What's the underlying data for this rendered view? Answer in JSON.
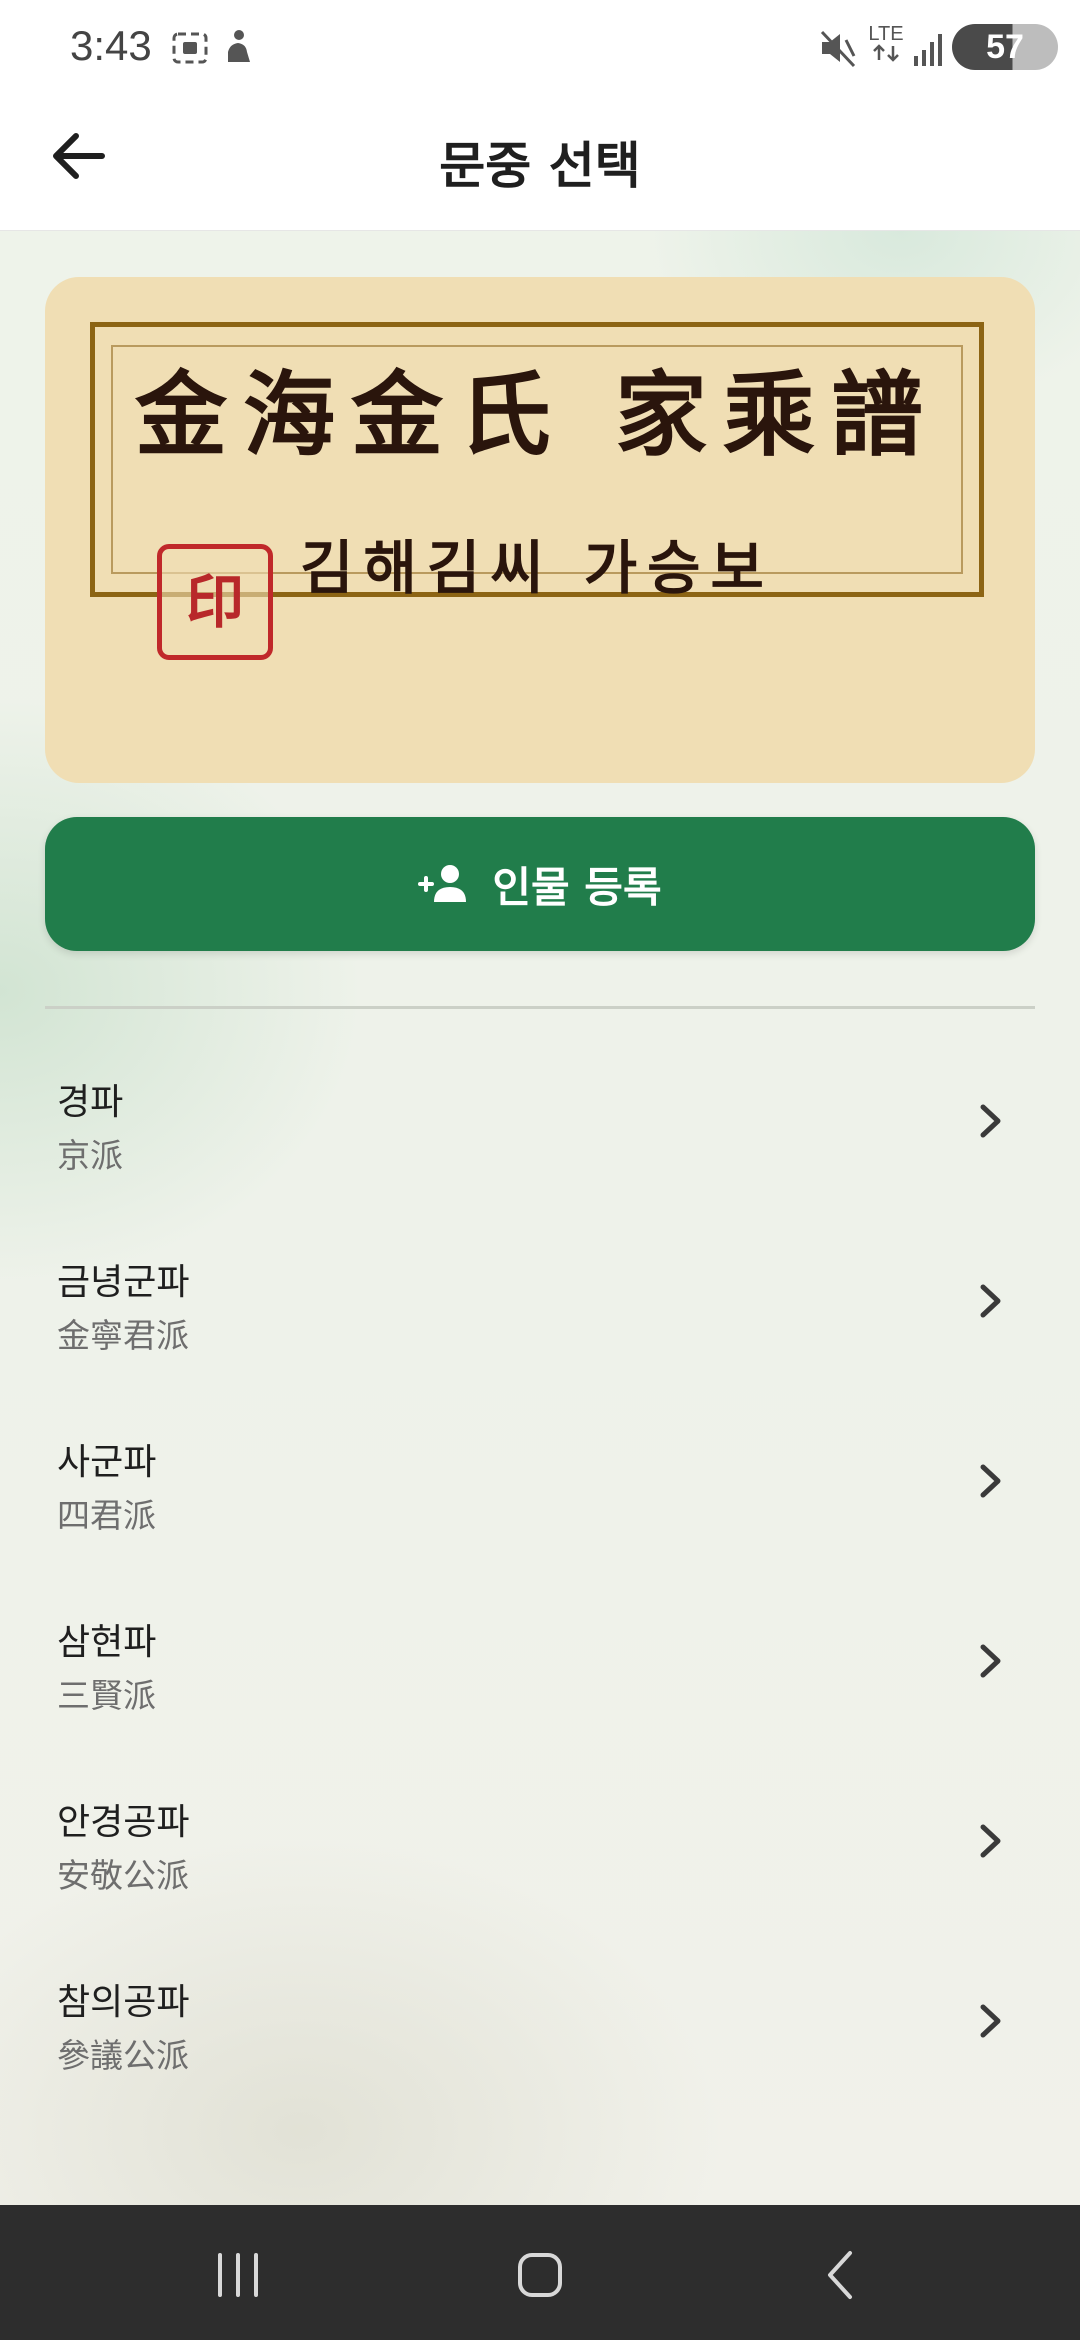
{
  "status_bar": {
    "time": "3:43",
    "network": "LTE",
    "battery": "57",
    "icons": [
      "screenshot-icon",
      "accessibility-icon",
      "mute-icon",
      "data-arrows-icon",
      "signal-icon"
    ]
  },
  "app_bar": {
    "back_icon": "arrow-left-icon",
    "title": "문중 선택"
  },
  "hero": {
    "hanja_title": "金海金氏 家乘譜",
    "seal_text": "印",
    "korean_title": "김해김씨 가승보",
    "colors": {
      "card_bg": "#f0deb4",
      "frame": "#8c6414",
      "seal": "#c0282a"
    }
  },
  "register_button": {
    "icon": "person-add-icon",
    "label": "인물 등록",
    "color": "#217d4b"
  },
  "branches": [
    {
      "name": "경파",
      "hanja": "京派"
    },
    {
      "name": "금녕군파",
      "hanja": "金寧君派"
    },
    {
      "name": "사군파",
      "hanja": "四君派"
    },
    {
      "name": "삼현파",
      "hanja": "三賢派"
    },
    {
      "name": "안경공파",
      "hanja": "安敬公派"
    },
    {
      "name": "참의공파",
      "hanja": "參議公派"
    }
  ],
  "nav_bar": {
    "icons": [
      "recent-apps-icon",
      "home-icon",
      "back-icon"
    ]
  }
}
